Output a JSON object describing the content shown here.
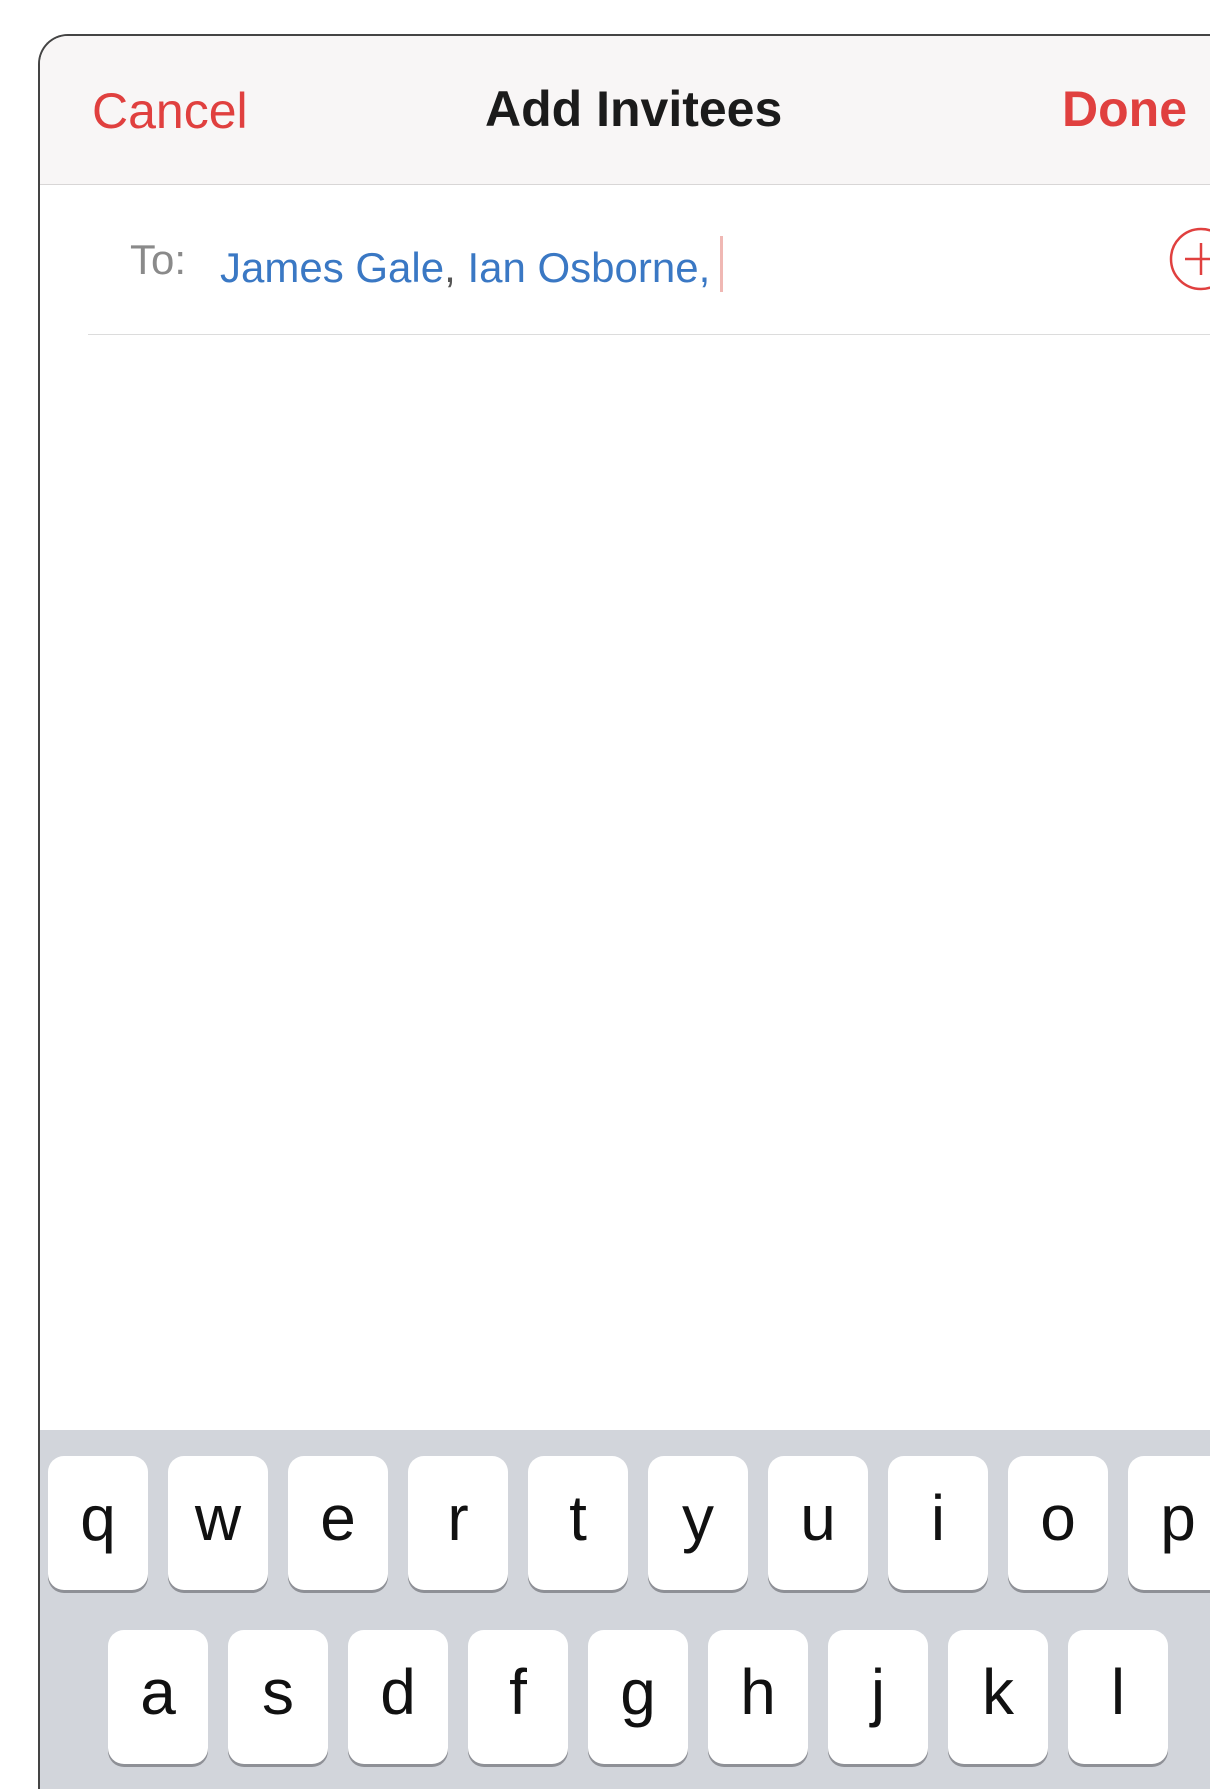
{
  "navbar": {
    "cancel_label": "Cancel",
    "title": "Add Invitees",
    "done_label": "Done"
  },
  "to_field": {
    "label": "To:",
    "recipients": [
      "James Gale",
      "Ian Osborne"
    ],
    "separator": ","
  },
  "keyboard": {
    "row1": [
      "q",
      "w",
      "e",
      "r",
      "t",
      "y",
      "u",
      "i",
      "o",
      "p"
    ],
    "row2": [
      "a",
      "s",
      "d",
      "f",
      "g",
      "h",
      "j",
      "k",
      "l"
    ]
  },
  "icons": {
    "add_contact": "plus-circle-icon"
  },
  "colors": {
    "accent": "#e0403f",
    "recipient": "#3a78c4",
    "keyboard_bg": "#d2d5db"
  }
}
